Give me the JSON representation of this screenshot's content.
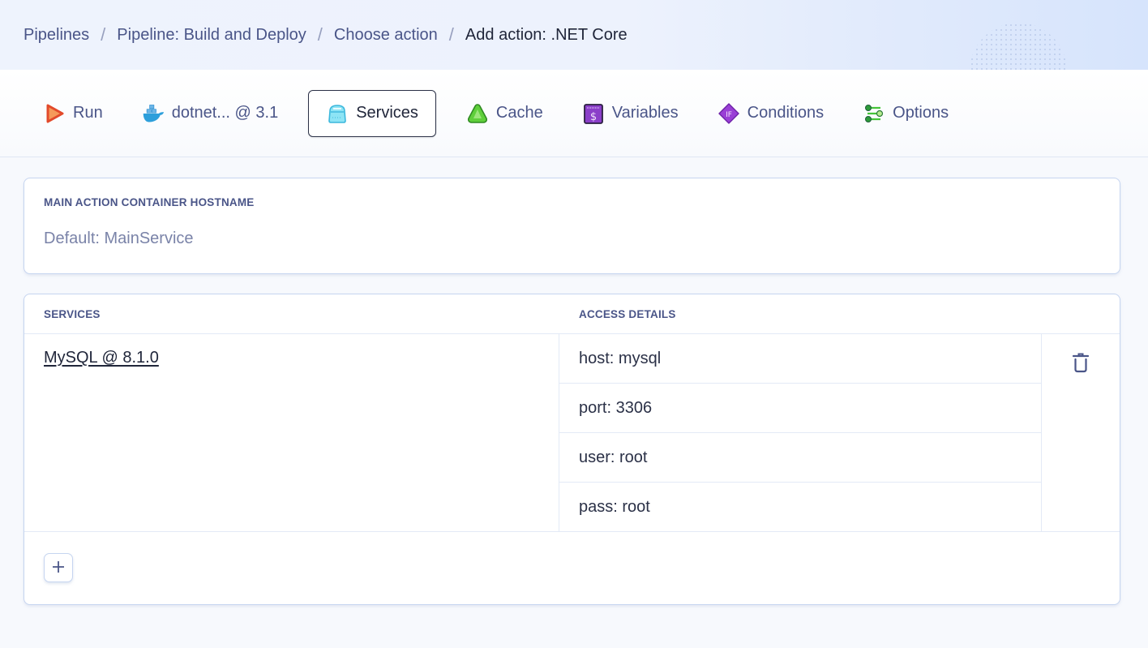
{
  "breadcrumb": {
    "items": [
      {
        "label": "Pipelines",
        "current": false
      },
      {
        "label": "Pipeline: Build and Deploy",
        "current": false
      },
      {
        "label": "Choose action",
        "current": false
      },
      {
        "label": "Add action: .NET Core",
        "current": true
      }
    ],
    "separator": "/"
  },
  "tabs": [
    {
      "label": "Run",
      "icon": "run-icon",
      "active": false
    },
    {
      "label": "dotnet... @ 3.1",
      "icon": "docker-icon",
      "active": false
    },
    {
      "label": "Services",
      "icon": "services-icon",
      "active": true
    },
    {
      "label": "Cache",
      "icon": "cache-icon",
      "active": false
    },
    {
      "label": "Variables",
      "icon": "variables-icon",
      "active": false
    },
    {
      "label": "Conditions",
      "icon": "conditions-icon",
      "active": false
    },
    {
      "label": "Options",
      "icon": "options-icon",
      "active": false
    }
  ],
  "hostname": {
    "label": "MAIN ACTION CONTAINER HOSTNAME",
    "value": "",
    "placeholder": "Default: MainService"
  },
  "services": {
    "headers": {
      "services": "SERVICES",
      "access": "ACCESS DETAILS"
    },
    "rows": [
      {
        "name": "MySQL @ 8.1.0",
        "details": [
          "host: mysql",
          "port: 3306",
          "user: root",
          "pass: root"
        ]
      }
    ],
    "add_label": "+"
  },
  "colors": {
    "accent": "#4a5588",
    "text_dark": "#20263a",
    "border": "#c6d5f0"
  }
}
